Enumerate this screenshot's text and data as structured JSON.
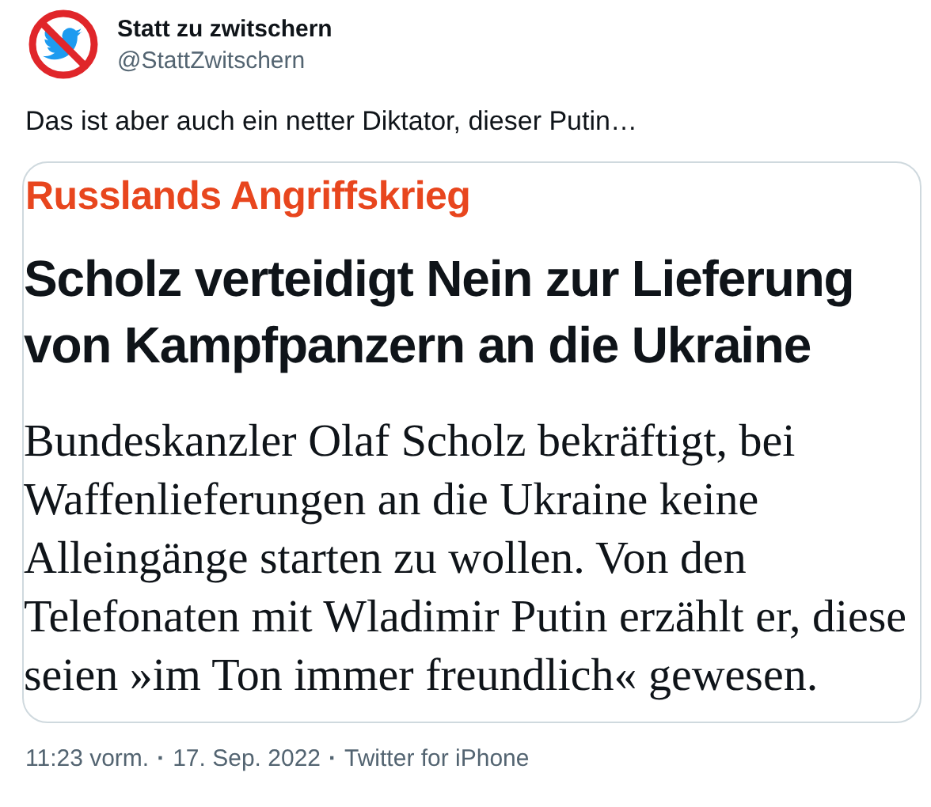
{
  "author": {
    "name": "Statt zu zwitschern",
    "handle": "@StattZwitschern"
  },
  "tweet_text": "Das ist aber auch ein netter Diktator, dieser Putin…",
  "article_card": {
    "kicker": "Russlands Angriffskrieg",
    "headline": "Scholz verteidigt Nein zur Lieferung von Kampfpanzern an die Ukraine",
    "body_lines": [
      "Bundeskanzler Olaf Scholz bekräftigt, bei",
      "Waffenlieferungen an die Ukraine keine",
      "Alleingänge starten zu wollen. Von den",
      "Telefonaten mit Wladimir Putin erzählt er, diese",
      "seien »im Ton immer freundlich« gewesen."
    ]
  },
  "meta": [
    {
      "kind": "time",
      "text": "11:23 vorm."
    },
    {
      "kind": "separator",
      "text": "·"
    },
    {
      "kind": "date",
      "text": "17. Sep. 2022"
    },
    {
      "kind": "separator",
      "text": "·"
    },
    {
      "kind": "source",
      "text": "Twitter for iPhone"
    }
  ]
}
